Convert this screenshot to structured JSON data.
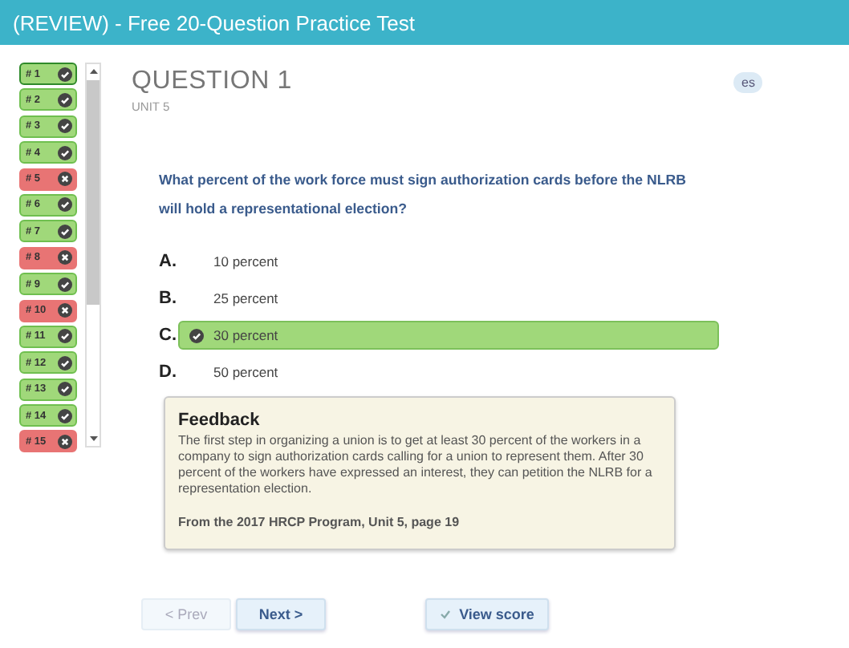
{
  "window": {
    "title": "(REVIEW) - Free 20-Question Practice Test"
  },
  "questions": [
    {
      "label": "# 1",
      "correct": true,
      "selected": true
    },
    {
      "label": "# 2",
      "correct": true,
      "selected": false
    },
    {
      "label": "# 3",
      "correct": true,
      "selected": false
    },
    {
      "label": "# 4",
      "correct": true,
      "selected": false
    },
    {
      "label": "# 5",
      "correct": false,
      "selected": false
    },
    {
      "label": "# 6",
      "correct": true,
      "selected": false
    },
    {
      "label": "# 7",
      "correct": true,
      "selected": false
    },
    {
      "label": "# 8",
      "correct": false,
      "selected": false
    },
    {
      "label": "# 9",
      "correct": true,
      "selected": false
    },
    {
      "label": "# 10",
      "correct": false,
      "selected": false
    },
    {
      "label": "# 11",
      "correct": true,
      "selected": false
    },
    {
      "label": "# 12",
      "correct": true,
      "selected": false
    },
    {
      "label": "# 13",
      "correct": true,
      "selected": false
    },
    {
      "label": "# 14",
      "correct": true,
      "selected": false
    },
    {
      "label": "# 15",
      "correct": false,
      "selected": false
    }
  ],
  "question": {
    "title": "QUESTION 1",
    "unit": "UNIT 5",
    "language": "es",
    "text": "What percent of the work force must sign authorization cards before the NLRB will hold a representational election?"
  },
  "options": [
    {
      "letter": "A.",
      "text": "10 percent",
      "selected": false
    },
    {
      "letter": "B.",
      "text": "25 percent",
      "selected": false
    },
    {
      "letter": "C.",
      "text": "30 percent",
      "selected": true
    },
    {
      "letter": "D.",
      "text": "50 percent",
      "selected": false
    }
  ],
  "feedback": {
    "title": "Feedback",
    "text": "The first step in organizing a union is to get at least 30 percent of the workers in a company to sign authorization cards calling for a union to represent them.  After 30 percent of the workers have expressed an interest, they can petition the NLRB for a representation election.",
    "source": "From the 2017 HRCP Program, Unit 5, page 19"
  },
  "buttons": [
    {
      "label": "< Prev",
      "disabled": true
    },
    {
      "label": "Next >",
      "disabled": false
    }
  ],
  "score_button": {
    "label": "View score"
  }
}
